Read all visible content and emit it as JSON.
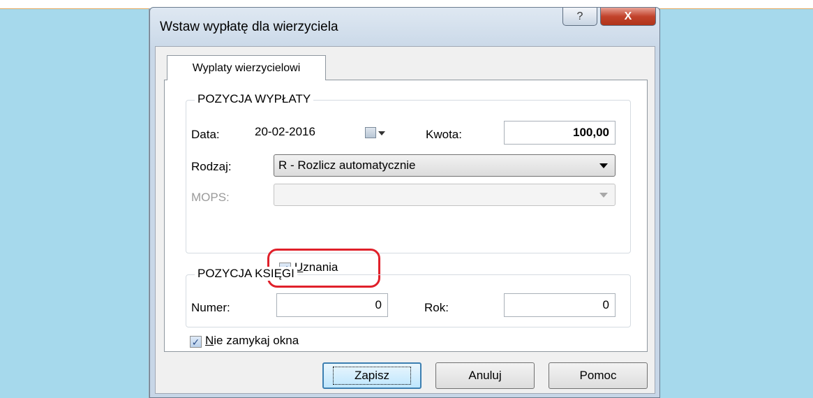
{
  "window": {
    "title": "Wstaw wypłatę dla wierzyciela",
    "help_glyph": "?",
    "close_glyph": "X"
  },
  "tabs": [
    {
      "label": "Wyplaty wierzycielowi",
      "active": true
    }
  ],
  "payment_group": {
    "title": "POZYCJA WYPŁATY",
    "date_label": "Data:",
    "date_value": "20-02-2016",
    "amount_label": "Kwota:",
    "amount_value": "100,00",
    "type_label": "Rodzaj:",
    "type_value": "R - Rozlicz automatycznie",
    "mops_label": "MOPS:",
    "mops_value": "",
    "acknowledgments": {
      "label_u": "U",
      "label_rest": "znania",
      "checked": true
    }
  },
  "ledger_group": {
    "title": "POZYCJA KSIĘGI",
    "number_label": "Numer:",
    "number_value": "0",
    "year_label": "Rok:",
    "year_value": "0"
  },
  "keep_open": {
    "label_u": "N",
    "label_rest": "ie zamykaj okna",
    "checked": true
  },
  "buttons": {
    "save": "Zapisz",
    "cancel": "Anuluj",
    "help": "Pomoc"
  },
  "colors": {
    "background": "#a6d9ec",
    "highlight": "#e0202a",
    "close_button": "#c2432c"
  }
}
